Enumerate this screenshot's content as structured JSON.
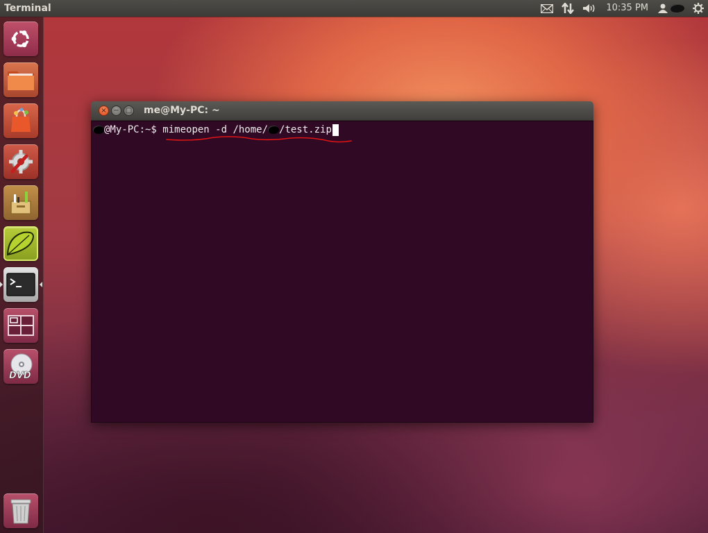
{
  "top_panel": {
    "app_title": "Terminal",
    "indicators": [
      {
        "icon": "envelope-icon"
      },
      {
        "icon": "network-arrows-icon"
      },
      {
        "icon": "volume-icon"
      },
      {
        "icon": "user-icon"
      },
      {
        "icon": "gear-icon"
      }
    ],
    "clock": "10:35 PM"
  },
  "launcher": {
    "items": [
      {
        "name": "dash-home",
        "icon": "ubuntu-logo-icon"
      },
      {
        "name": "files",
        "icon": "folder-icon"
      },
      {
        "name": "software-center",
        "icon": "shopping-bag-icon"
      },
      {
        "name": "system-settings",
        "icon": "settings-wrench-icon"
      },
      {
        "name": "text-editor",
        "icon": "toolbox-icon"
      },
      {
        "name": "app-green",
        "icon": "green-leaf-icon"
      },
      {
        "name": "terminal",
        "icon": "terminal-icon",
        "active": true
      },
      {
        "name": "workspace-switcher",
        "icon": "workspaces-icon"
      },
      {
        "name": "dvd",
        "icon": "dvd-icon"
      },
      {
        "name": "trash",
        "icon": "trash-icon"
      }
    ]
  },
  "terminal": {
    "title": "me@My-PC: ~",
    "prompt_host": "@My-PC:~$ ",
    "command_part1": "mimeopen -d /home/",
    "command_part2": "/test.zip",
    "window_buttons": {
      "close": "×",
      "minimize": "−",
      "maximize": "□"
    }
  },
  "colors": {
    "terminal_bg": "#300a24",
    "panel_bg": "#3c3b37",
    "annotation_underline": "#e01414",
    "close_button": "#df4a16"
  }
}
